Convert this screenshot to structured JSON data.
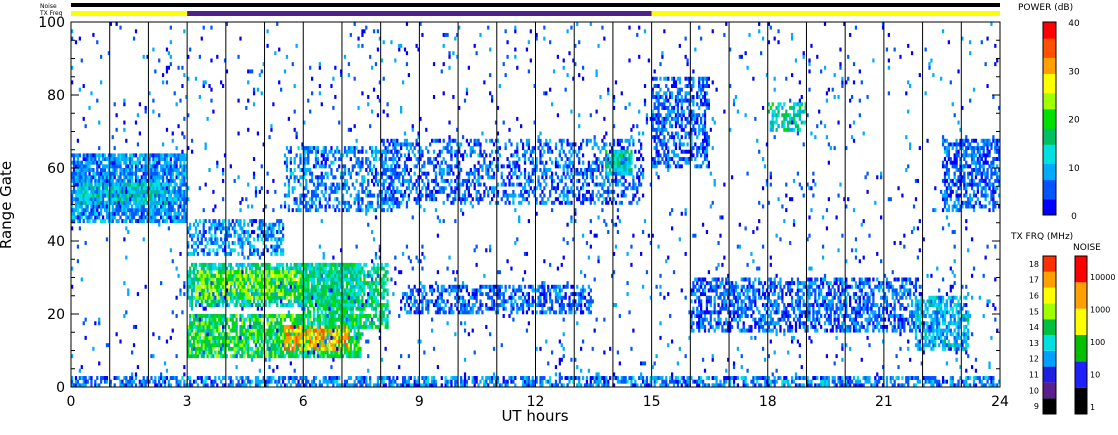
{
  "chart_data": {
    "type": "heatmap",
    "title": "",
    "xlabel": "UT hours",
    "ylabel": "Range Gate",
    "xlim": [
      0,
      24
    ],
    "ylim": [
      0,
      100
    ],
    "x_ticks": [
      0,
      3,
      6,
      9,
      12,
      15,
      18,
      21,
      24
    ],
    "y_ticks": [
      0,
      20,
      40,
      60,
      80,
      100
    ],
    "scan_lines_hours": [
      0,
      1,
      2,
      3,
      4,
      5,
      6,
      7,
      8,
      9,
      10,
      11,
      12,
      13,
      14,
      15,
      16,
      17,
      18,
      19,
      20,
      21,
      22,
      23
    ],
    "status_bars": {
      "noise_label": "Noise",
      "txfreq_label": "TX Freq",
      "txfreq_segments": [
        {
          "start": 0,
          "end": 3,
          "color": "#ffff00"
        },
        {
          "start": 3,
          "end": 15,
          "color": "#50208a"
        },
        {
          "start": 15,
          "end": 24,
          "color": "#ffff00"
        }
      ]
    },
    "power_colorbar": {
      "label": "POWER (dB)",
      "range": [
        0,
        40
      ],
      "ticks": [
        "0",
        "10",
        "20",
        "30",
        "40"
      ],
      "colors": [
        "#0000ff",
        "#0055ff",
        "#00aaff",
        "#00e0e0",
        "#00c060",
        "#00e000",
        "#a0ff00",
        "#ffff00",
        "#ffa000",
        "#ff5000",
        "#ff0000"
      ]
    },
    "txfreq_colorbar": {
      "label": "TX FRQ (MHz)",
      "ticks": [
        "9",
        "10",
        "11",
        "12",
        "13",
        "14",
        "15",
        "16",
        "17",
        "18"
      ],
      "colors": [
        "#000000",
        "#5a1f8c",
        "#2020e0",
        "#00a0ff",
        "#00e0e0",
        "#00c040",
        "#a0ff00",
        "#ffff00",
        "#ffa000",
        "#ff3000"
      ]
    },
    "noise_colorbar": {
      "label": "NOISE",
      "ticks": [
        "1",
        "10",
        "100",
        "1000",
        "10000"
      ],
      "colors": [
        "#000000",
        "#2020ff",
        "#00c000",
        "#ffff00",
        "#ffa000",
        "#ff0000"
      ]
    },
    "echo_regions": [
      {
        "t0": 0.0,
        "t1": 3.0,
        "g0": 45,
        "g1": 64,
        "power": 8,
        "density": 0.8
      },
      {
        "t0": 0.2,
        "t1": 2.6,
        "g0": 50,
        "g1": 56,
        "power": 11,
        "density": 0.85
      },
      {
        "t0": 3.0,
        "t1": 7.5,
        "g0": 22,
        "g1": 34,
        "power": 14,
        "density": 0.75
      },
      {
        "t0": 3.2,
        "t1": 6.0,
        "g0": 24,
        "g1": 32,
        "power": 22,
        "density": 0.7
      },
      {
        "t0": 3.0,
        "t1": 7.5,
        "g0": 8,
        "g1": 20,
        "power": 18,
        "density": 0.8
      },
      {
        "t0": 5.5,
        "t1": 7.2,
        "g0": 10,
        "g1": 17,
        "power": 30,
        "density": 0.7
      },
      {
        "t0": 6.0,
        "t1": 8.2,
        "g0": 16,
        "g1": 34,
        "power": 16,
        "density": 0.6
      },
      {
        "t0": 3.0,
        "t1": 5.5,
        "g0": 36,
        "g1": 46,
        "power": 8,
        "density": 0.5
      },
      {
        "t0": 5.5,
        "t1": 8.5,
        "g0": 48,
        "g1": 66,
        "power": 7,
        "density": 0.4
      },
      {
        "t0": 8.0,
        "t1": 14.8,
        "g0": 50,
        "g1": 68,
        "power": 6,
        "density": 0.4
      },
      {
        "t0": 13.8,
        "t1": 14.5,
        "g0": 58,
        "g1": 65,
        "power": 14,
        "density": 0.7
      },
      {
        "t0": 8.5,
        "t1": 13.5,
        "g0": 20,
        "g1": 28,
        "power": 6,
        "density": 0.5
      },
      {
        "t0": 15.0,
        "t1": 16.5,
        "g0": 60,
        "g1": 85,
        "power": 6,
        "density": 0.5
      },
      {
        "t0": 16.0,
        "t1": 22.0,
        "g0": 15,
        "g1": 30,
        "power": 6,
        "density": 0.55
      },
      {
        "t0": 18.0,
        "t1": 19.0,
        "g0": 70,
        "g1": 78,
        "power": 14,
        "density": 0.5
      },
      {
        "t0": 21.8,
        "t1": 23.2,
        "g0": 10,
        "g1": 25,
        "power": 10,
        "density": 0.6
      },
      {
        "t0": 22.5,
        "t1": 24.0,
        "g0": 48,
        "g1": 68,
        "power": 6,
        "density": 0.55
      },
      {
        "t0": 0.0,
        "t1": 24.0,
        "g0": 0,
        "g1": 3,
        "power": 7,
        "density": 0.6
      },
      {
        "t0": 0.0,
        "t1": 24.0,
        "g0": 0,
        "g1": 100,
        "power": 5,
        "density": 0.03
      }
    ]
  }
}
